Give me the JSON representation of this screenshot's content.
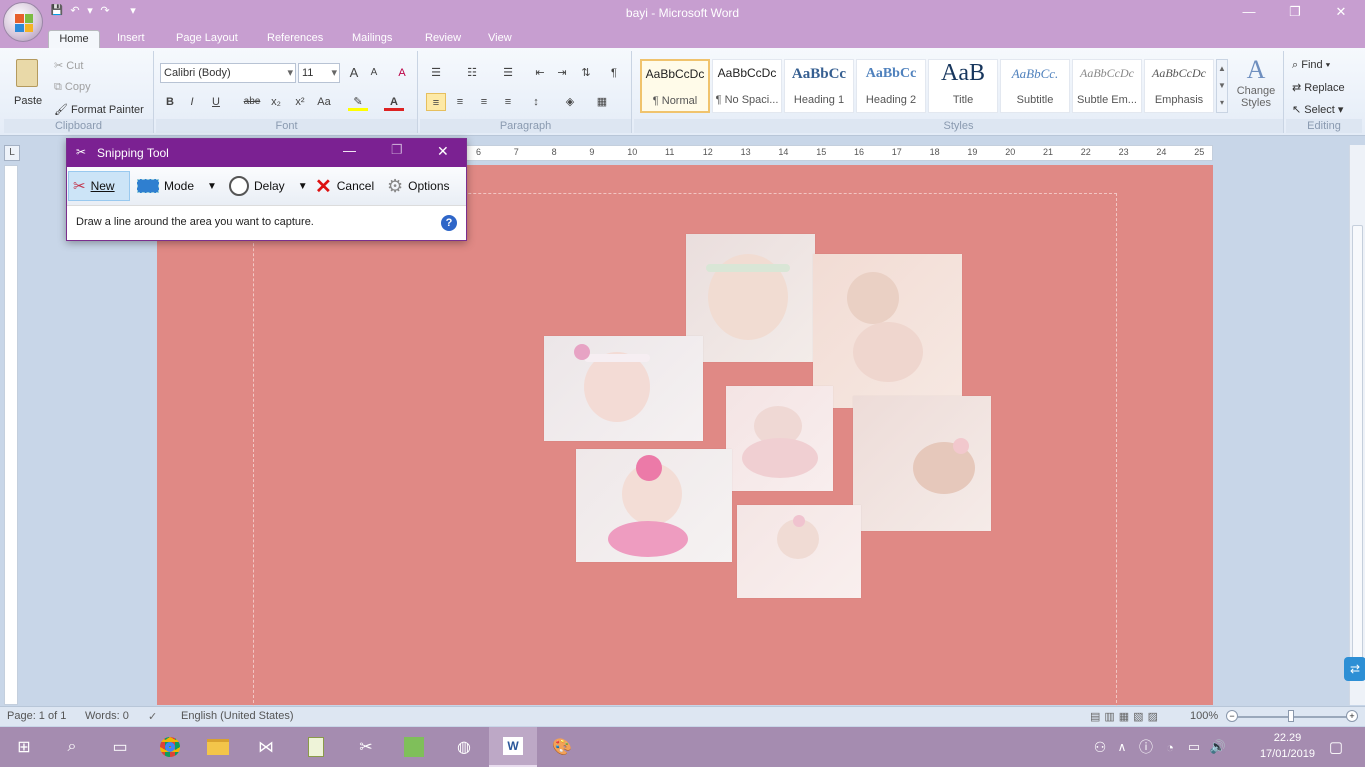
{
  "window": {
    "title": "bayi - Microsoft Word",
    "minimize": "—",
    "restore": "❐",
    "close": "✕"
  },
  "qat": {
    "save": "💾",
    "undo": "↶",
    "redo": "↷",
    "more": "▾"
  },
  "tabs": [
    "Home",
    "Insert",
    "Page Layout",
    "References",
    "Mailings",
    "Review",
    "View"
  ],
  "clipboard": {
    "paste": "Paste",
    "cut": "Cut",
    "copy": "Copy",
    "format_painter": "Format Painter",
    "label": "Clipboard"
  },
  "font": {
    "name": "Calibri (Body)",
    "size": "11",
    "label": "Font",
    "bold": "B",
    "italic": "I",
    "underline": "U",
    "strike": "abe",
    "subscript": "x₂",
    "superscript": "x²",
    "change_case": "Aa",
    "grow": "A",
    "shrink": "A",
    "clear": "A"
  },
  "paragraph": {
    "label": "Paragraph",
    "pilcrow": "¶"
  },
  "styles": {
    "label": "Styles",
    "change_styles": "Change Styles",
    "items": [
      {
        "sample": "AaBbCcDc",
        "name": "¶ Normal"
      },
      {
        "sample": "AaBbCcDc",
        "name": "¶ No Spaci..."
      },
      {
        "sample": "AaBbCc",
        "name": "Heading 1"
      },
      {
        "sample": "AaBbCc",
        "name": "Heading 2"
      },
      {
        "sample": "AaB",
        "name": "Title"
      },
      {
        "sample": "AaBbCc.",
        "name": "Subtitle"
      },
      {
        "sample": "AaBbCcDc",
        "name": "Subtle Em..."
      },
      {
        "sample": "AaBbCcDc",
        "name": "Emphasis"
      }
    ]
  },
  "editing": {
    "find": "Find",
    "replace": "Replace",
    "select": "Select",
    "label": "Editing"
  },
  "ruler": {
    "numbers": [
      "6",
      "7",
      "8",
      "9",
      "10",
      "11",
      "12",
      "13",
      "14",
      "15",
      "16",
      "17",
      "18",
      "19",
      "20",
      "21",
      "22",
      "23",
      "24",
      "25"
    ],
    "corner": "L"
  },
  "status": {
    "page": "Page: 1 of 1",
    "words": "Words: 0",
    "language": "English (United States)",
    "zoom": "100%"
  },
  "snipping": {
    "title": "Snipping Tool",
    "new": "New",
    "mode": "Mode",
    "delay": "Delay",
    "cancel": "Cancel",
    "options": "Options",
    "message": "Draw a line around the area you want to capture.",
    "help": "?"
  },
  "clock": {
    "time": "22.29",
    "date": "17/01/2019"
  },
  "colors": {
    "titlebar": "#c79ed0",
    "page": "#e08985",
    "snip_title": "#7b2192",
    "taskbar": "#a58cb0"
  }
}
